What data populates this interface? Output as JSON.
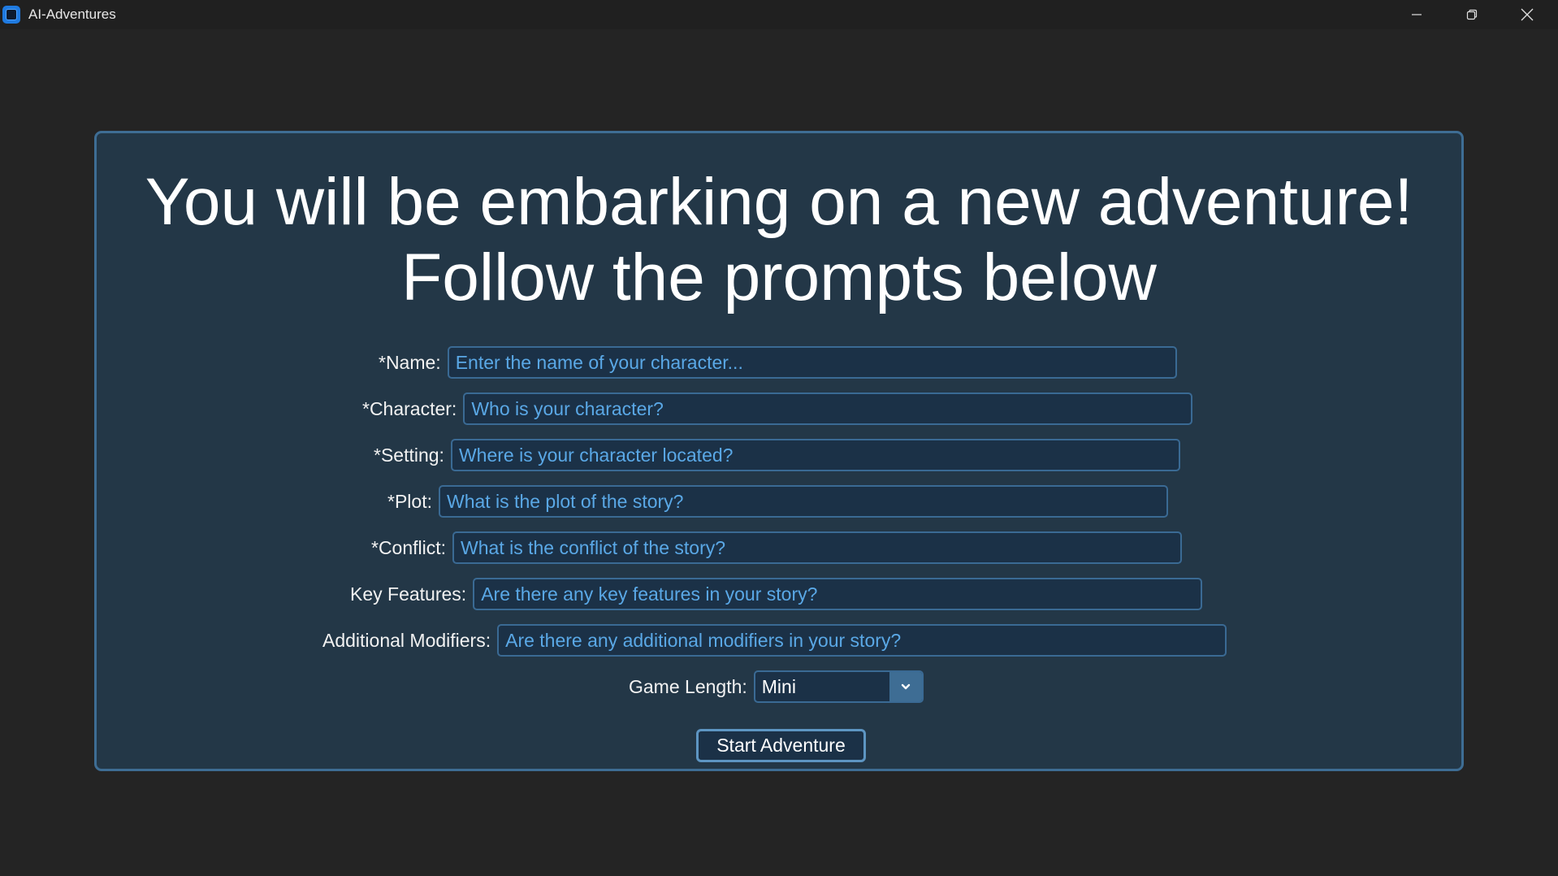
{
  "window": {
    "title": "AI-Adventures",
    "icon": "app-icon"
  },
  "heading": {
    "line1": "You will be embarking on a new adventure!",
    "line2": "Follow the prompts below"
  },
  "form": {
    "name": {
      "label": "*Name:",
      "placeholder": "Enter the name of your character..."
    },
    "character": {
      "label": "*Character:",
      "placeholder": "Who is your character?"
    },
    "setting": {
      "label": "*Setting:",
      "placeholder": "Where is your character located?"
    },
    "plot": {
      "label": "*Plot:",
      "placeholder": "What is the plot of the story?"
    },
    "conflict": {
      "label": "*Conflict:",
      "placeholder": "What is the conflict of the story?"
    },
    "key_features": {
      "label": "Key Features:",
      "placeholder": "Are there any key features in your story?"
    },
    "additional_modifiers": {
      "label": "Additional Modifiers:",
      "placeholder": "Are there any additional modifiers in your story?"
    },
    "game_length": {
      "label": "Game Length:",
      "value": "Mini"
    },
    "start_label": "Start Adventure"
  },
  "colors": {
    "background": "#242424",
    "panel": "#233747",
    "panel_border": "#3e6d94",
    "field_bg": "#1b3147",
    "placeholder": "#5aa8e6"
  }
}
